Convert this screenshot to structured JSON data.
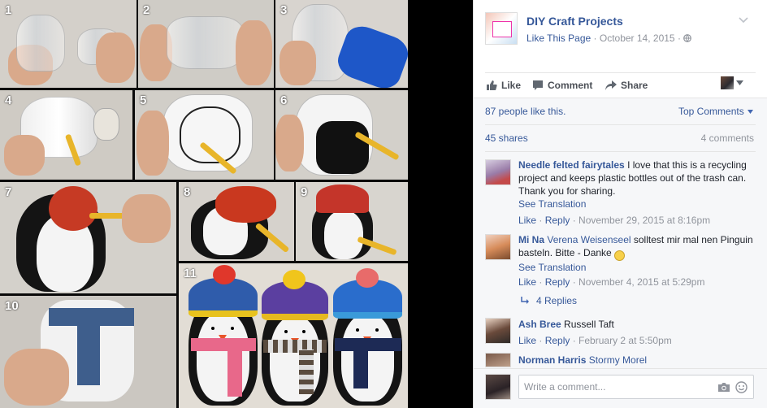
{
  "photo": {
    "tile_numbers": [
      "1",
      "2",
      "3",
      "4",
      "5",
      "6",
      "7",
      "8",
      "9",
      "10",
      "11"
    ]
  },
  "post": {
    "page_name": "DIY Craft Projects",
    "like_page": "Like This Page",
    "dot": "·",
    "date": "October 14, 2015",
    "globe_icon": "globe-icon"
  },
  "actions": {
    "like": "Like",
    "comment": "Comment",
    "share": "Share"
  },
  "stats": {
    "likes": "87 people like this.",
    "sort": "Top Comments",
    "shares": "45 shares",
    "comments": "4 comments"
  },
  "comments": [
    {
      "author": "Needle felted fairytales",
      "text": " I love that this is a recycling project and keeps plastic bottles out of the trash can. Thank you for sharing.",
      "translation": "See Translation",
      "like": "Like",
      "reply": "Reply",
      "time": "November 29, 2015 at 8:16pm"
    },
    {
      "author": "Mi Na",
      "tag": "Verena Weisenseel",
      "text": " solltest mir mal nen Pinguin basteln. Bitte - Danke ",
      "emoji": "🙂",
      "translation": "See Translation",
      "like": "Like",
      "reply": "Reply",
      "time": "November 4, 2015 at 5:29pm",
      "replies": "4 Replies"
    },
    {
      "author": "Ash Bree",
      "tag": "Russell Taft",
      "like": "Like",
      "reply": "Reply",
      "time": "February 2 at 5:50pm"
    },
    {
      "author": "Norman Harris",
      "tag": "Stormy Morel"
    }
  ],
  "composer": {
    "placeholder": "Write a comment..."
  },
  "colors": {
    "link": "#365899",
    "muted": "#90949c",
    "accent_blue": "#4267b2"
  }
}
